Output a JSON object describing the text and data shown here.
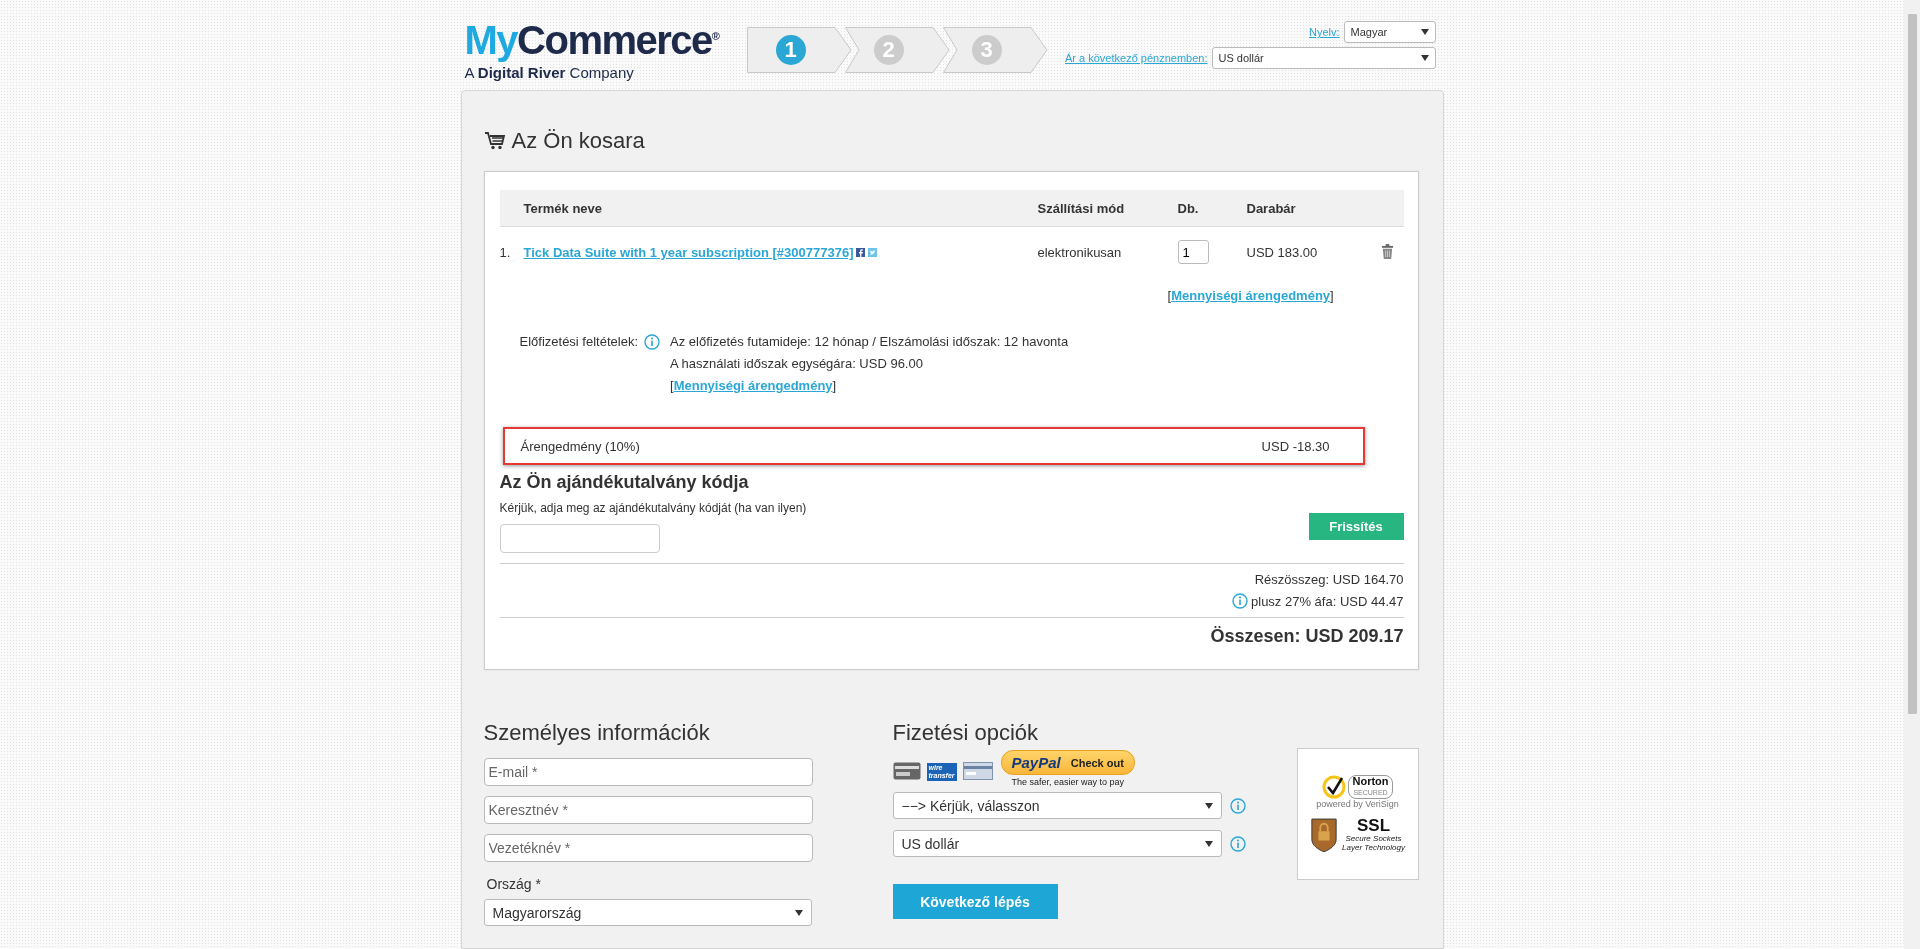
{
  "logo": {
    "accent": "My",
    "rest": "Commerce",
    "mark": "®",
    "tagline": "A **Digital River** Company"
  },
  "steps": [
    {
      "label": "1",
      "selected": true
    },
    {
      "label": "2",
      "selected": false
    },
    {
      "label": "3",
      "selected": false
    }
  ],
  "language": {
    "label": "Nyelv:",
    "value": "Magyar"
  },
  "currency": {
    "label": "Ár a következő pénznemben:",
    "value": "US dollár"
  },
  "cart": {
    "title": "Az Ön kosara",
    "columns": [
      "Termék neve",
      "Szállítási mód",
      "Db.",
      "Darabár"
    ],
    "items": [
      {
        "index": "1.",
        "name": "Tick Data Suite with 1 year subscription [#300777376]",
        "delivery": "elektronikusan",
        "quantity": "1",
        "price": "USD 183.00",
        "volume_discount": {
          "open": "[",
          "link": "Mennyiségi árengedmény",
          "close": "]"
        },
        "subscription": {
          "label": "Előfizetési feltételek:",
          "lines": [
            "Az előfizetés futamideje: 12 hónap / Elszámolási időszak: 12 havonta",
            "A használati időszak egységára: USD 96.00"
          ],
          "volume_discount": {
            "open": "[",
            "link": "Mennyiségi árengedmény",
            "close": "]"
          }
        }
      }
    ],
    "discount": {
      "label": "Árengedmény (10%)",
      "amount": "USD -18.30",
      "highlighted": true
    },
    "coupon": {
      "title": "Az Ön ajándékutalvány kódja",
      "hint": "Kérjük, adja meg az ajándékutalvány kódját (ha van ilyen)",
      "button": "Frissítés"
    },
    "subtotal": "Részösszeg: USD 164.70",
    "tax": "plusz 27% áfa: USD 44.47",
    "total": "Összesen: USD 209.17"
  },
  "personal": {
    "title": "Személyes információk",
    "fields": [
      {
        "placeholder": "E-mail *"
      },
      {
        "placeholder": "Keresztnév *"
      },
      {
        "placeholder": "Vezetéknév *"
      }
    ],
    "country": {
      "label": "Ország *",
      "value": "Magyarország"
    }
  },
  "payment": {
    "title": "Fizetési opciók",
    "methods": [
      {
        "kind": "card"
      },
      {
        "kind": "wire",
        "lines": [
          "wire",
          "transfer"
        ]
      },
      {
        "kind": "bank"
      }
    ],
    "paypal": {
      "brand": "PayPal",
      "action": "Check out",
      "slogan": "The safer, easier way to pay"
    },
    "selects": [
      {
        "value": "−−> Kérjük, válasszon"
      },
      {
        "value": "US dollár"
      }
    ],
    "button": "Következő lépés"
  },
  "seals": {
    "norton": {
      "name": "Norton",
      "status": "SECURED",
      "powered": "powered by VeriSign"
    },
    "ssl": {
      "name": "SSL",
      "lines": [
        "Secure Sockets",
        "Layer Technology"
      ]
    }
  }
}
